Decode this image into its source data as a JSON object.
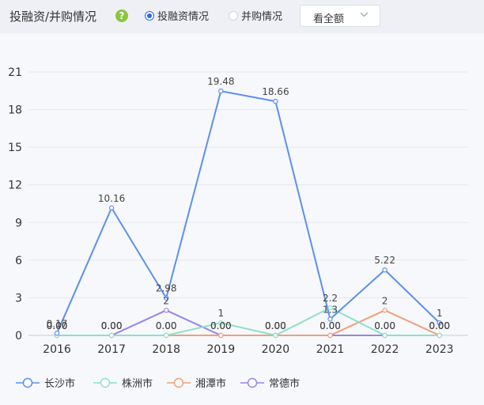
{
  "header": {
    "title": "投融资/并购情况",
    "help_icon": "question-icon",
    "radio_options": [
      {
        "label": "投融资情况",
        "checked": true
      },
      {
        "label": "并购情况",
        "checked": false
      }
    ],
    "select_value": "看全额"
  },
  "chart_data": {
    "type": "line",
    "categories": [
      "2016",
      "2017",
      "2018",
      "2019",
      "2020",
      "2021",
      "2022",
      "2023"
    ],
    "ylim": [
      0,
      21
    ],
    "yticks": [
      0,
      3,
      6,
      9,
      12,
      15,
      18,
      21
    ],
    "grid": true,
    "legend_position": "bottom-left",
    "series": [
      {
        "name": "长沙市",
        "color": "#5b8ff0",
        "values": [
          0.17,
          10.16,
          2.98,
          19.48,
          18.66,
          1.3,
          5.22,
          1
        ],
        "labels": [
          "0.17",
          "10.16",
          "2.98",
          "19.48",
          "18.66",
          "1.3",
          "5.22",
          "1"
        ]
      },
      {
        "name": "株洲市",
        "color": "#8ee0c8",
        "values": [
          0,
          0,
          0,
          1,
          0,
          2.2,
          0,
          0
        ],
        "labels": [
          "0.00",
          "0.00",
          "0.00",
          "1",
          "0.00",
          "2.2",
          "0.00",
          "0.00"
        ]
      },
      {
        "name": "湘潭市",
        "color": "#f0a07a",
        "values": [
          0,
          0,
          0,
          0,
          0,
          0,
          2,
          0
        ],
        "labels": [
          "0.00",
          "0.00",
          "0.00",
          "0.00",
          "0.00",
          "0.00",
          "2",
          "0.00"
        ]
      },
      {
        "name": "常德市",
        "color": "#9a83ec",
        "values": [
          0,
          0,
          2,
          0,
          0,
          0,
          0,
          0
        ],
        "labels": [
          "0.00",
          "0.00",
          "2",
          "0.00",
          "0.00",
          "0.00",
          "0.00",
          "0.00"
        ]
      }
    ]
  }
}
